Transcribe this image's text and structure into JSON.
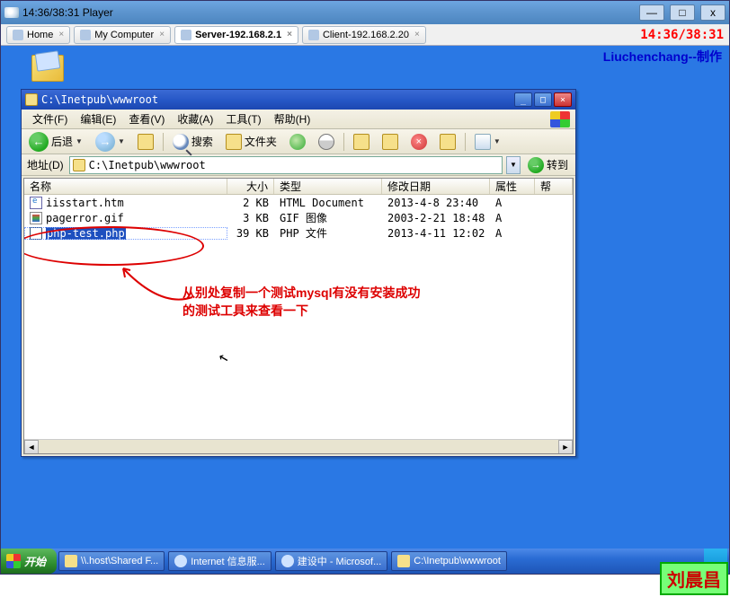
{
  "vm": {
    "title": "14:36/38:31 Player",
    "min": "—",
    "max": "□",
    "close": "x"
  },
  "timestamp_top": "14:36/38:31",
  "credit_line": "Liuchenchang--制作",
  "tabs": [
    {
      "label": "Home"
    },
    {
      "label": "My Computer"
    },
    {
      "label": "Server-192.168.2.1",
      "active": true
    },
    {
      "label": "Client-192.168.2.20"
    }
  ],
  "explorer": {
    "title": "C:\\Inetpub\\wwwroot",
    "menu": {
      "file": "文件(F)",
      "edit": "编辑(E)",
      "view": "查看(V)",
      "fav": "收藏(A)",
      "tools": "工具(T)",
      "help": "帮助(H)"
    },
    "toolbar": {
      "back": "后退",
      "search": "搜索",
      "folders": "文件夹"
    },
    "address_label": "地址(D)",
    "address_path": "C:\\Inetpub\\wwwroot",
    "go": "转到",
    "columns": {
      "name": "名称",
      "size": "大小",
      "type": "类型",
      "date": "修改日期",
      "attr": "属性",
      "last": "帮"
    },
    "files": [
      {
        "name": "iisstart.htm",
        "size": "2 KB",
        "type": "HTML Document",
        "date": "2013-4-8 23:40",
        "attr": "A",
        "icon": "htm"
      },
      {
        "name": "pagerror.gif",
        "size": "3 KB",
        "type": "GIF 图像",
        "date": "2003-2-21 18:48",
        "attr": "A",
        "icon": "gif"
      },
      {
        "name": "php-test.php",
        "size": "39 KB",
        "type": "PHP 文件",
        "date": "2013-4-11 12:02",
        "attr": "A",
        "icon": "php",
        "selected": true
      }
    ],
    "annotation_line1": "从别处复制一个测试mysql有没有安装成功",
    "annotation_line2": "的测试工具来查看一下"
  },
  "taskbar": {
    "start": "开始",
    "items": [
      {
        "label": "\\\\.host\\Shared F...",
        "icon": "folder"
      },
      {
        "label": "Internet 信息服...",
        "icon": "ie"
      },
      {
        "label": "建设中 - Microsof...",
        "icon": "ie"
      },
      {
        "label": "C:\\Inetpub\\wwwroot",
        "icon": "folder"
      }
    ]
  },
  "watermark": "刘晨昌"
}
